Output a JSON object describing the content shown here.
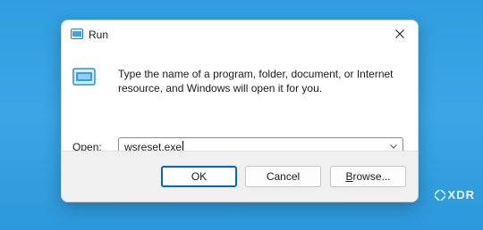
{
  "window": {
    "title": "Run",
    "close_icon": "close-icon",
    "title_icon": "run-app-icon"
  },
  "body": {
    "description": "Type the name of a program, folder, document, or Internet resource, and Windows will open it for you.",
    "open_label_mnemonic": "O",
    "open_label_rest": "pen:",
    "open_value": "wsreset.exe",
    "dropdown_icon": "chevron-down-icon"
  },
  "buttons": {
    "ok": "OK",
    "cancel": "Cancel",
    "browse_mnemonic": "B",
    "browse_rest": "rowse..."
  },
  "watermark": {
    "text": "XDR"
  },
  "colors": {
    "accent": "#0067c0",
    "desktop": "#3aa6e6"
  }
}
